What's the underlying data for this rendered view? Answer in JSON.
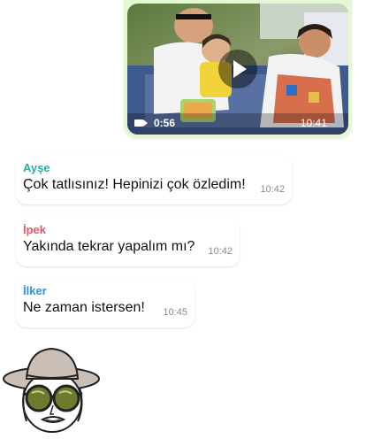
{
  "video_message": {
    "duration": "0:56",
    "time": "10:41",
    "read_checks": "✓✓"
  },
  "messages": [
    {
      "sender": "Ayşe",
      "sender_color": "#1fb3a6",
      "text": "Çok tatlısınız! Hepinizi çok özledim!",
      "time": "10:42"
    },
    {
      "sender": "İpek",
      "sender_color": "#e25a67",
      "text": "Yakında tekrar yapalım mı?",
      "time": "10:42"
    },
    {
      "sender": "İlker",
      "sender_color": "#2f8fe0",
      "text": "Ne zaman istersen!",
      "time": "10:45"
    }
  ],
  "icons": {
    "play": "play-icon",
    "video_camera": "video-camera-icon",
    "read_receipt": "double-check-icon",
    "avatar": "sticker-hat-sunglasses"
  }
}
